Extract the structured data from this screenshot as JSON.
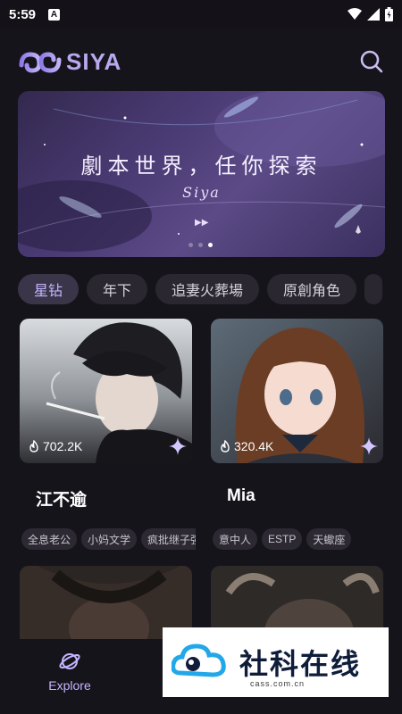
{
  "status": {
    "time": "5:59",
    "notification_letter": "A"
  },
  "app": {
    "name": "SIYA"
  },
  "banner": {
    "title": "劇本世界，任你探索",
    "subtitle": "Siya",
    "arrows": "▶▶",
    "page_count": 3,
    "active_page": 3
  },
  "tags": [
    "星钻",
    "年下",
    "追妻火葬場",
    "原創角色"
  ],
  "selected_tag": "星钻",
  "cards": [
    {
      "name": "江不逾",
      "count": "702.2K",
      "tags": [
        "全息老公",
        "小妈文学",
        "疯批继子强"
      ]
    },
    {
      "name": "Mia",
      "count": "320.4K",
      "tags": [
        "意中人",
        "ESTP",
        "天蠍座"
      ]
    }
  ],
  "nav": {
    "explore_label": "Explore"
  },
  "watermark": {
    "text": "社科在线",
    "domain": "cass.com.cn"
  },
  "colors": {
    "accent": "#c6b5ff",
    "logo": "#b9a8ee",
    "background": "#16141b",
    "chip": "#2a2731"
  }
}
